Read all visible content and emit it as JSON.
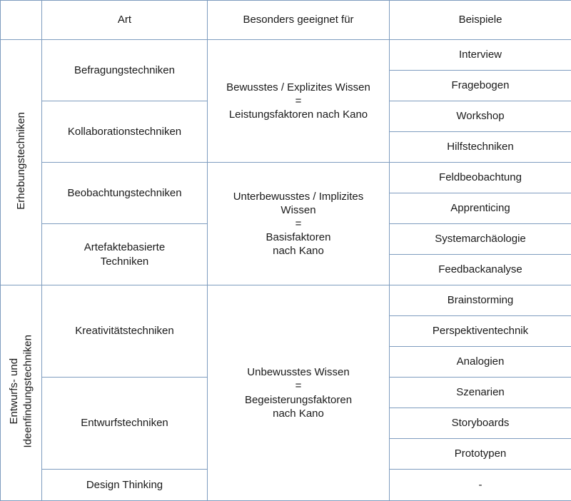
{
  "table": {
    "columns": [
      {
        "key": "side",
        "label": ""
      },
      {
        "key": "art",
        "label": "Art"
      },
      {
        "key": "geeignet",
        "label": "Besonders geeignet für"
      },
      {
        "key": "beispiele",
        "label": "Beispiele"
      }
    ],
    "sections": [
      {
        "label": "Erhebungstechniken",
        "art": [
          "Befragungstechniken",
          "Kollaborationstechniken",
          "Beobachtungstechniken",
          "Artefaktebasierte\nTechniken"
        ],
        "geeignet": [
          "Bewusstes / Explizites Wissen\n=\nLeistungsfaktoren nach Kano",
          "Unterbewusstes / Implizites\nWissen\n=\nBasisfaktoren\nnach Kano"
        ],
        "beispiele": [
          "Interview",
          "Fragebogen",
          "Workshop",
          "Hilfstechniken",
          "Feldbeobachtung",
          "Apprenticing",
          "Systemarchäologie",
          "Feedbackanalyse"
        ]
      },
      {
        "label": "Entwurfs- und\nIdeenfindungstechniken",
        "art": [
          "Kreativitätstechniken",
          "Entwurfstechniken",
          "Design Thinking"
        ],
        "geeignet": [
          "Unbewusstes Wissen\n=\nBegeisterungsfaktoren\nnach Kano"
        ],
        "beispiele": [
          "Brainstorming",
          "Perspektiventechnik",
          "Analogien",
          "Szenarien",
          "Storyboards",
          "Prototypen",
          "-"
        ]
      }
    ]
  },
  "colors": {
    "header_fill": "#C3D1E6",
    "border": "#7E9CBF",
    "header_border": "#5F7FA6",
    "cell_fill": "#FFFFFF",
    "text": "#1A1A1A"
  }
}
